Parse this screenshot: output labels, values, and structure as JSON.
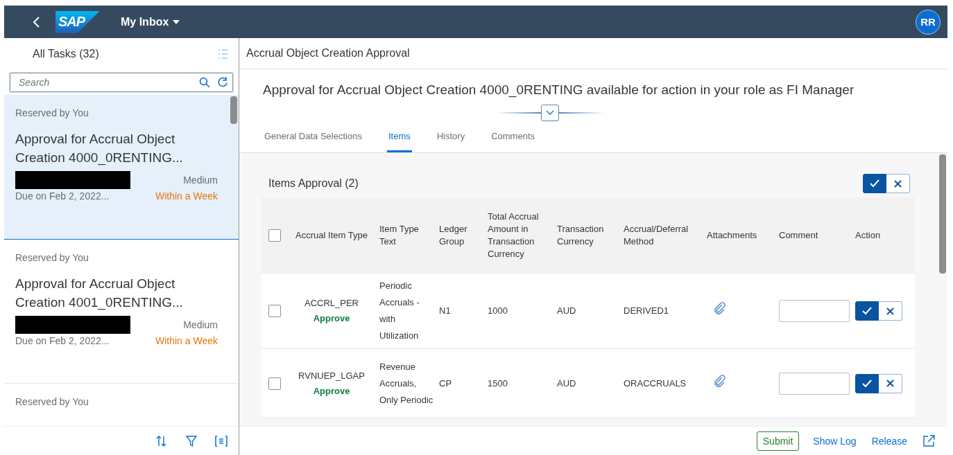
{
  "header": {
    "logo": "SAP",
    "title": "My Inbox",
    "avatar": "RR"
  },
  "task_list": {
    "title": "All Tasks (32)",
    "search": {
      "placeholder": "Search"
    },
    "items": [
      {
        "status": "Reserved by You",
        "title": "Approval for Accrual Object Creation 4000_0RENTING...",
        "redacted": true,
        "priority": "Medium",
        "due": "Due on Feb 2, 2022...",
        "deadline": "Within a Week",
        "selected": true
      },
      {
        "status": "Reserved by You",
        "title": "Approval for Accrual Object Creation 4001_0RENTING...",
        "redacted": true,
        "priority": "Medium",
        "due": "Due on Feb 2, 2022...",
        "deadline": "Within a Week",
        "selected": false
      },
      {
        "status": "Reserved by You",
        "selected": false
      }
    ]
  },
  "detail": {
    "title": "Accrual Object Creation Approval",
    "heading": "Approval for Accrual Object Creation 4000_0RENTING available for action in your role as FI Manager",
    "tabs": [
      {
        "label": "General Data Selections",
        "selected": false
      },
      {
        "label": "Items",
        "selected": true
      },
      {
        "label": "History",
        "selected": false
      },
      {
        "label": "Comments",
        "selected": false
      }
    ],
    "items_table": {
      "title": "Items Approval (2)",
      "select_all": {
        "checked": false
      },
      "columns": [
        "Accrual Item Type",
        "Item Type Text",
        "Ledger Group",
        "Total Accrual Amount in Transaction Currency",
        "Transaction Currency",
        "Accrual/Deferral Method",
        "Attachments",
        "Comment",
        "Action"
      ],
      "rows": [
        {
          "checked": false,
          "item_type": "ACCRL_PER",
          "decision": "Approve",
          "item_type_text": "Periodic Accruals - with Utilization",
          "ledger_group": "N1",
          "amount": "1000",
          "currency": "AUD",
          "method": "DERIVED1"
        },
        {
          "checked": false,
          "item_type": "RVNUEP_LGAP",
          "decision": "Approve",
          "item_type_text": "Revenue Accruals, Only Periodic",
          "ledger_group": "CP",
          "amount": "1500",
          "currency": "AUD",
          "method": "ORACCRUALS"
        }
      ]
    }
  },
  "footer": {
    "actions": [
      {
        "label": "Submit",
        "kind": "outlined"
      },
      {
        "label": "Show Log",
        "kind": "link"
      },
      {
        "label": "Release",
        "kind": "link"
      }
    ]
  }
}
